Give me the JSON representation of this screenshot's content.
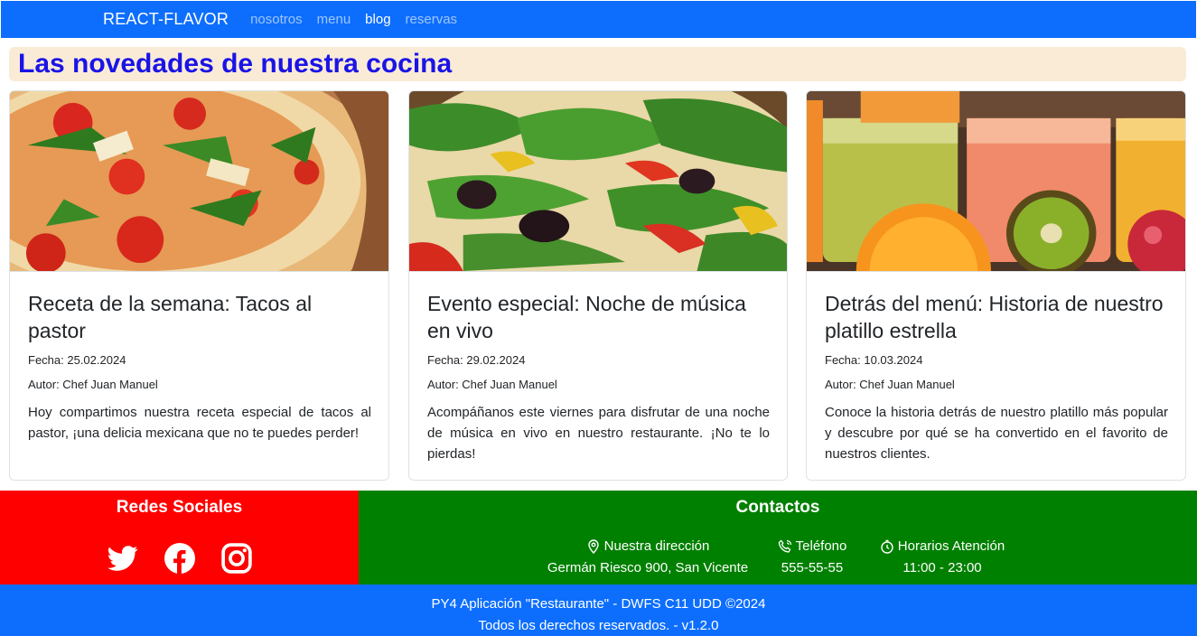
{
  "navbar": {
    "brand": "REACT-FLAVOR",
    "links": [
      {
        "label": "nosotros",
        "active": false
      },
      {
        "label": "menu",
        "active": false
      },
      {
        "label": "blog",
        "active": true
      },
      {
        "label": "reservas",
        "active": false
      }
    ]
  },
  "page": {
    "title": "Las novedades de nuestra cocina"
  },
  "cards": [
    {
      "image": "pizza-image",
      "title": "Receta de la semana: Tacos al pastor",
      "date": "Fecha: 25.02.2024",
      "author": "Autor: Chef Juan Manuel",
      "text": "Hoy compartimos nuestra receta especial de tacos al pastor, ¡una delicia mexicana que no te puedes perder!"
    },
    {
      "image": "salad-pizza-image",
      "title": "Evento especial: Noche de música en vivo",
      "date": "Fecha: 29.02.2024",
      "author": "Autor: Chef Juan Manuel",
      "text": "Acompáñanos este viernes para disfrutar de una noche de música en vivo en nuestro restaurante. ¡No te lo pierdas!"
    },
    {
      "image": "juices-image",
      "title": "Detrás del menú: Historia de nuestro platillo estrella",
      "date": "Fecha: 10.03.2024",
      "author": "Autor: Chef Juan Manuel",
      "text": "Conoce la historia detrás de nuestro platillo más popular y descubre por qué se ha convertido en el favorito de nuestros clientes."
    }
  ],
  "footer": {
    "social_title": "Redes Sociales",
    "social_icons": [
      "twitter-icon",
      "facebook-icon",
      "instagram-icon"
    ],
    "contacts_title": "Contactos",
    "address_label": "Nuestra dirección",
    "address_value": "Germán Riesco 900, San Vicente",
    "phone_label": "Teléfono",
    "phone_value": "555-55-55",
    "hours_label": "Horarios Atención",
    "hours_value": "11:00 - 23:00",
    "copyright_line1": "PY4 Aplicación \"Restaurante\" - DWFS C11 UDD ©2024",
    "copyright_line2": "Todos los derechos reservados. - v1.2.0"
  },
  "colors": {
    "nav_blue": "#0d6efd",
    "title_bg": "#faebd7",
    "title_text": "#1a14e6",
    "footer_red": "#ff0000",
    "footer_green": "#008000"
  }
}
